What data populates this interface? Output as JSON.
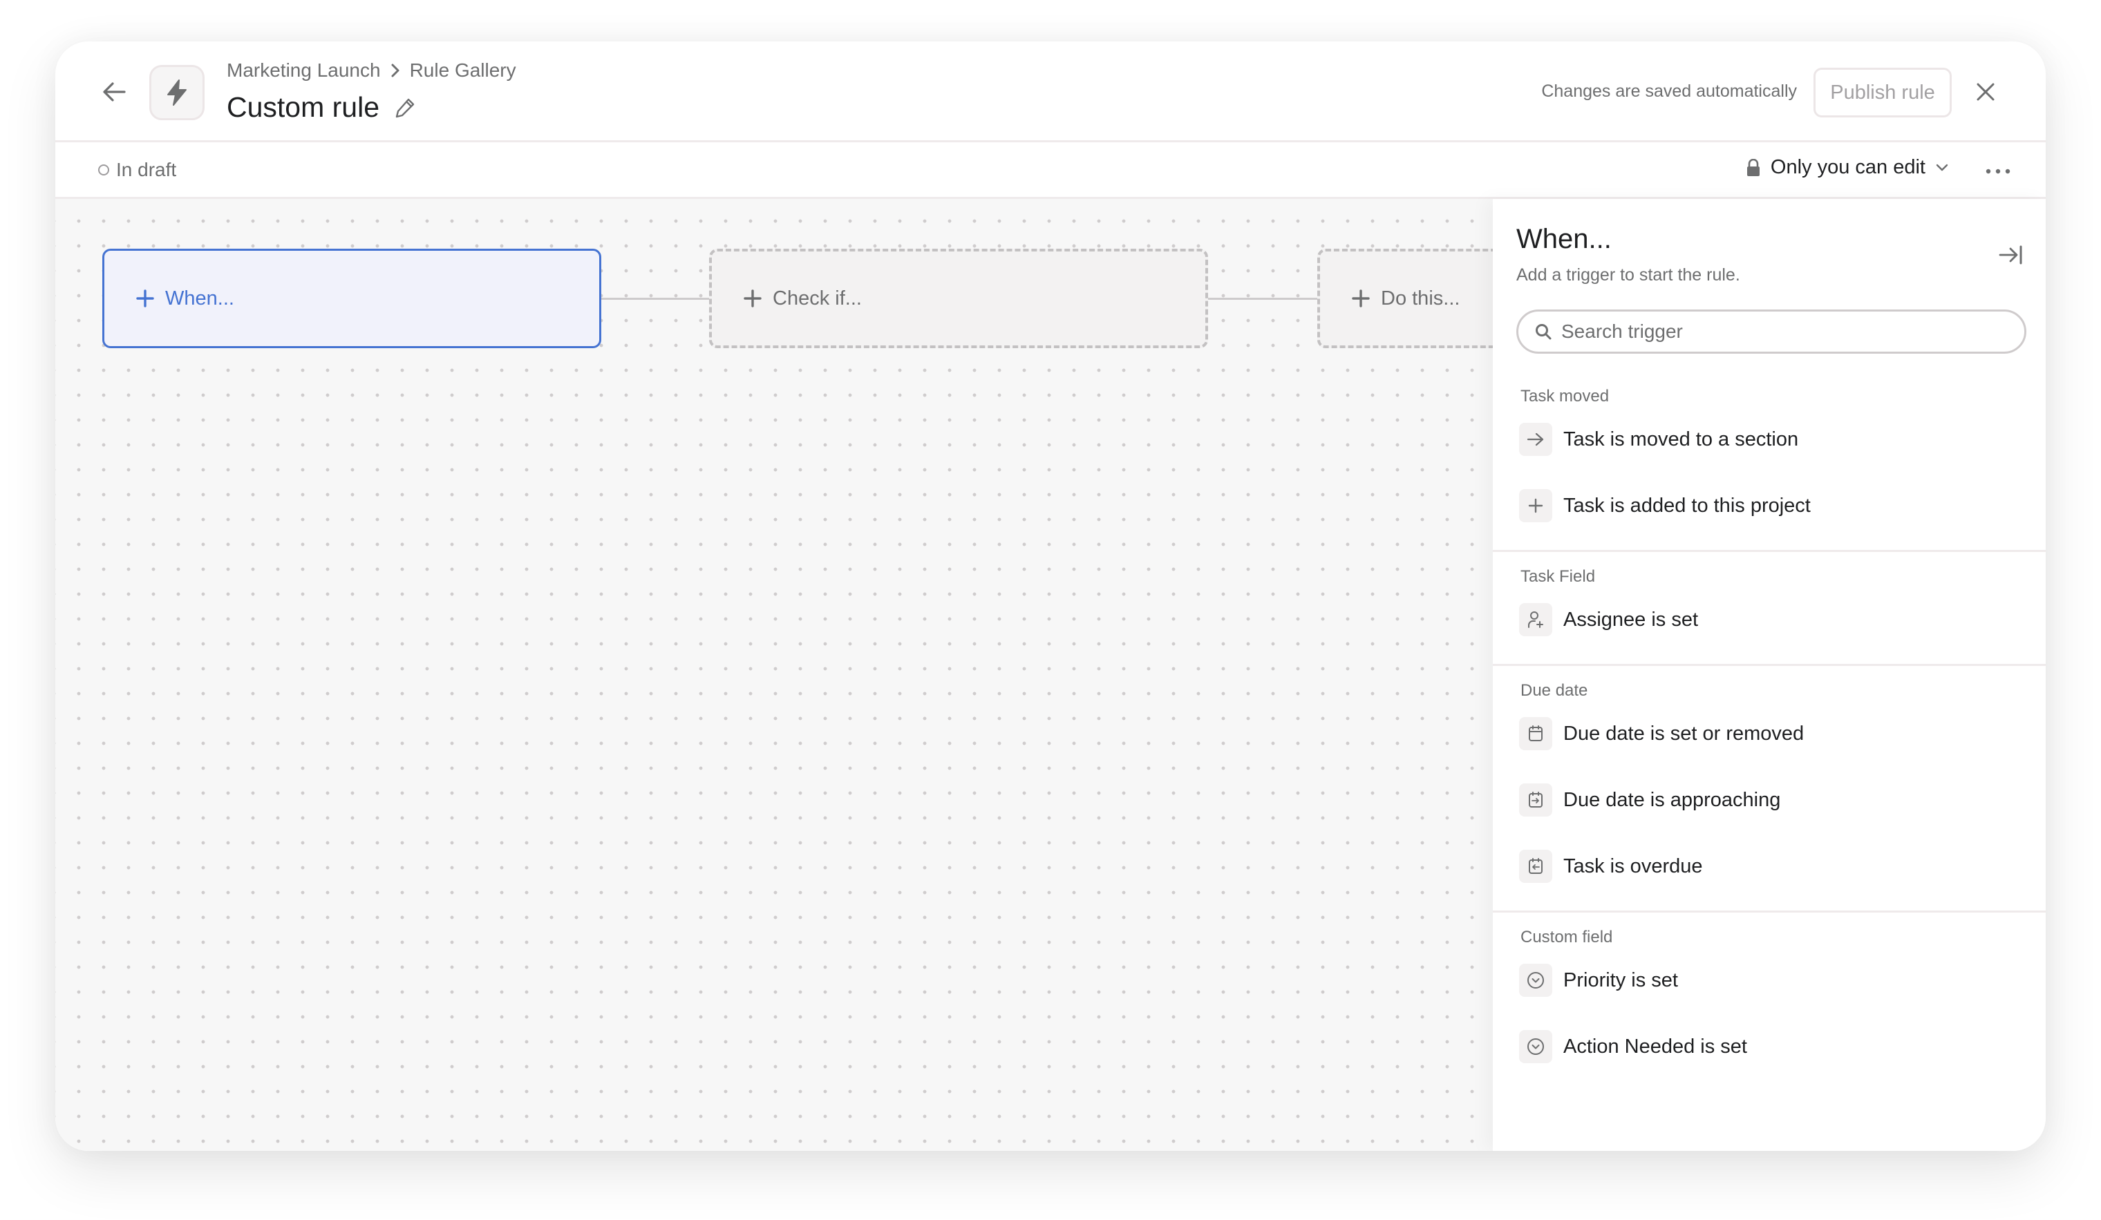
{
  "header": {
    "breadcrumb": [
      "Marketing Launch",
      "Rule Gallery"
    ],
    "title": "Custom rule",
    "saved_note": "Changes are saved automatically",
    "publish_label": "Publish rule"
  },
  "toolbar": {
    "status": "In draft",
    "permission": "Only you can edit"
  },
  "canvas": {
    "nodes": [
      {
        "label": "When...",
        "state": "active"
      },
      {
        "label": "Check if...",
        "state": "empty"
      },
      {
        "label": "Do this...",
        "state": "empty"
      }
    ]
  },
  "panel": {
    "title": "When...",
    "subtitle": "Add a trigger to start the rule.",
    "search_placeholder": "Search trigger",
    "search_value": "",
    "sections": [
      {
        "label": "Task moved",
        "items": [
          {
            "label": "Task is moved to a section",
            "icon": "arrow-right-icon"
          },
          {
            "label": "Task is added to this project",
            "icon": "plus-icon"
          }
        ]
      },
      {
        "label": "Task Field",
        "items": [
          {
            "label": "Assignee is set",
            "icon": "user-plus-icon"
          }
        ]
      },
      {
        "label": "Due date",
        "items": [
          {
            "label": "Due date is set or removed",
            "icon": "calendar-icon"
          },
          {
            "label": "Due date is approaching",
            "icon": "calendar-arrow-right-icon"
          },
          {
            "label": "Task is overdue",
            "icon": "calendar-arrow-left-icon"
          }
        ]
      },
      {
        "label": "Custom field",
        "items": [
          {
            "label": "Priority is set",
            "icon": "circle-chevron-down-icon"
          },
          {
            "label": "Action Needed is set",
            "icon": "circle-chevron-down-icon"
          }
        ]
      }
    ]
  },
  "colors": {
    "accent": "#4573d2",
    "active_node_bg": "#f1f2fb",
    "text_primary": "#1e1f21",
    "text_secondary": "#6d6e6f"
  }
}
